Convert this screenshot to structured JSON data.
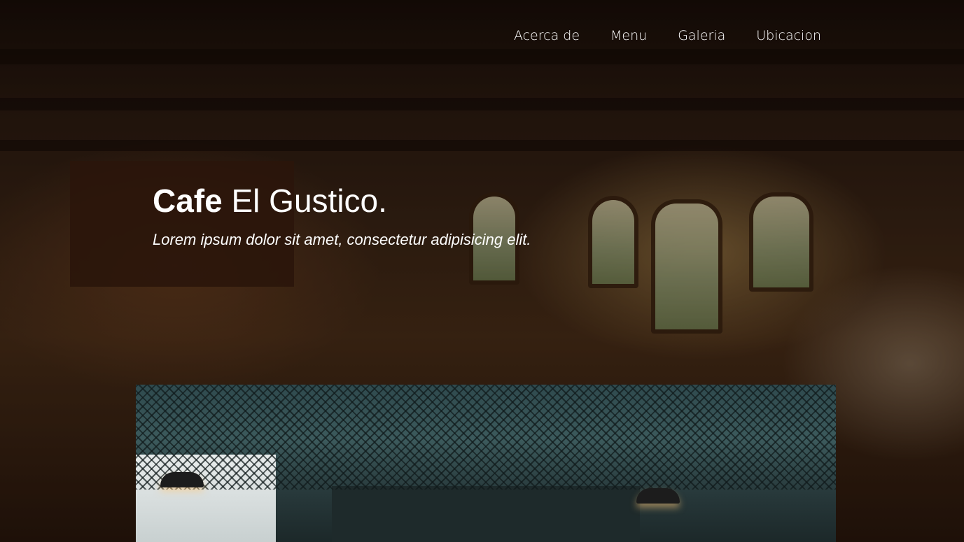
{
  "nav": {
    "items": [
      {
        "label": "Acerca de"
      },
      {
        "label": "Menu"
      },
      {
        "label": "Galeria"
      },
      {
        "label": "Ubicacion"
      }
    ]
  },
  "hero": {
    "title_bold": "Cafe",
    "title_rest": " El Gustico.",
    "tagline": "Lorem ipsum dolor sit amet, consectetur adipisicing elit."
  },
  "colors": {
    "text": "#ffffff",
    "background_dark": "#1a100a",
    "photo_tone": "#2f4a4e"
  }
}
